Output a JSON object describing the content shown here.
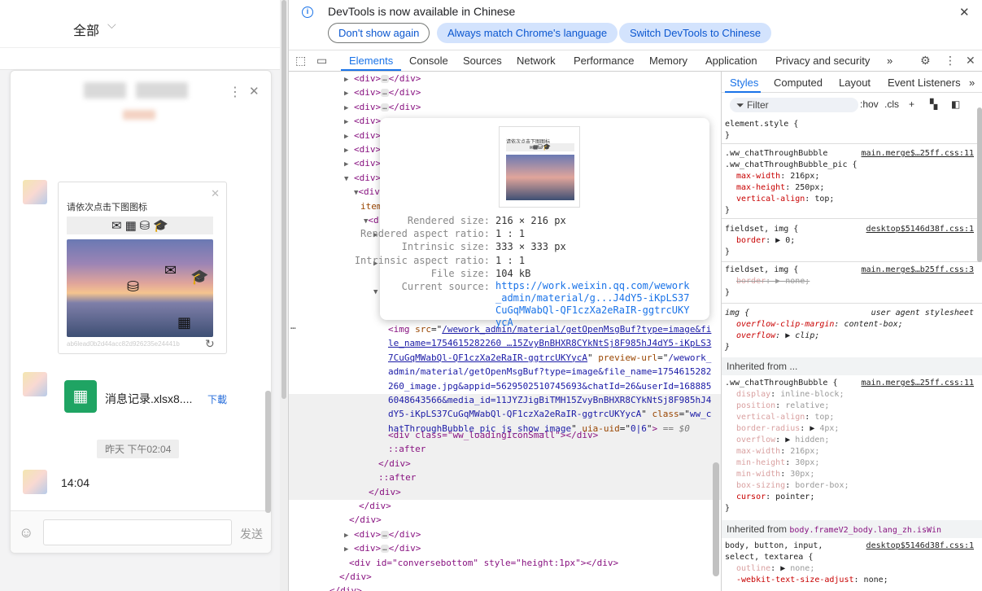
{
  "left": {
    "filter_label": "全部",
    "chat": {
      "card_title": "请依次点击下图图标",
      "card_hash": "ab6lead0b2d44acc82d926235e24441b",
      "file_name": "消息记录.xlsx8....",
      "download": "下載",
      "timestamp": "昨天 下午02:04",
      "text_message": "14:04",
      "send": "发送"
    }
  },
  "devtools": {
    "infobar": {
      "message": "DevTools is now available in Chinese",
      "btn_dont_show": "Don't show again",
      "btn_match": "Always match Chrome's language",
      "btn_switch": "Switch DevTools to Chinese"
    },
    "tabs": [
      "Elements",
      "Console",
      "Sources",
      "Network",
      "Performance",
      "Memory",
      "Application",
      "Privacy and security"
    ],
    "more": "»",
    "tooltip": {
      "rendered_size_k": "Rendered size:",
      "rendered_size_v": "216 × 216 px",
      "rendered_ratio_k": "Rendered aspect ratio:",
      "rendered_ratio_v": "1 : 1",
      "intrinsic_size_k": "Intrinsic size:",
      "intrinsic_size_v": "333 × 333 px",
      "intrinsic_ratio_k": "Intrinsic aspect ratio:",
      "intrinsic_ratio_v": "1 : 1",
      "file_size_k": "File size:",
      "file_size_v": "104 kB",
      "source_k": "Current source:",
      "source_v": "https://work.weixin.qq.com/wework_admin/material/g...J4dY5-iKpLS37CuGqMWabQl-QF1czXa2eRaIR-ggtrcUKYycA"
    },
    "elements": {
      "div_close": "</div>",
      "div_open": "<div>",
      "item_partial": "item",
      "img_src": "/wework_admin/material/getOpenMsgBuf?type=image&file_name=1754615282260 …15ZvyBnBHXR8CYkNtSj8F985hJ4dY5-iKpLS37CuGqMWabQl-QF1czXa2eRaIR-ggtrcUKYycA",
      "img_preview": "/wework_admin/material/getOpenMsgBuf?type=image&file_name=1754615282260_image.jpg&appid=5629502510745693&chatId=26&userId=1688856048643566&media_id=11JYZJigBiTMH15ZvyBnBHXR8CYkNtSj8F985hJ4dY5-iKpLS37CuGqMWabQl-QF1czXa2eRaIR-ggtrcUKYycA",
      "img_class": "ww_chatThroughBubble_pic js_show_image",
      "img_uia": "0|6",
      "eq": "== $0",
      "loading": "<div class=\"ww_loadingIconSmall\"></div>",
      "after": "::after",
      "conversebottom": "<div id=\"conversebottom\" style=\"height:1px\"></div>"
    },
    "styles": {
      "tabs": [
        "Styles",
        "Computed",
        "Layout",
        "Event Listeners"
      ],
      "filter": "Filter",
      "hov": ":hov",
      "cls": ".cls",
      "element_style": "element.style {",
      "r1_sel1": ".ww_chatThroughBubble",
      "r1_sel2": ".ww_chatThroughBubble_pic {",
      "r1_src": "main.merge$…25ff.css:11",
      "r1_p1": "max-width",
      "r1_v1": "216px;",
      "r1_p2": "max-height",
      "r1_v2": "250px;",
      "r1_p3": "vertical-align",
      "r1_v3": "top;",
      "r2_sel": "fieldset, img {",
      "r2_src": "desktop$5146d38f.css:1",
      "r2_p1": "border",
      "r2_v1": "0;",
      "r3_sel": "fieldset, img {",
      "r3_src": "main.merge$…b25ff.css:3",
      "r3_p1": "border",
      "r3_v1": "none;",
      "r4_sel": "img {",
      "r4_src": "user agent stylesheet",
      "r4_p1": "overflow-clip-margin",
      "r4_v1": "content-box;",
      "r4_p2": "overflow",
      "r4_v2": "clip;",
      "inh1": "Inherited from ...",
      "r5_sel": ".ww_chatThroughBubble {",
      "r5_src": "main.merge$…25ff.css:11",
      "r5_props": [
        {
          "n": "display",
          "v": "inline-block;"
        },
        {
          "n": "position",
          "v": "relative;"
        },
        {
          "n": "vertical-align",
          "v": "top;"
        },
        {
          "n": "border-radius",
          "v": "4px;"
        },
        {
          "n": "overflow",
          "v": "hidden;"
        },
        {
          "n": "max-width",
          "v": "216px;"
        },
        {
          "n": "min-height",
          "v": "30px;"
        },
        {
          "n": "min-width",
          "v": "30px;"
        },
        {
          "n": "box-sizing",
          "v": "border-box;"
        },
        {
          "n": "cursor",
          "v": "pointer;"
        }
      ],
      "inh2_prefix": "Inherited from",
      "inh2_el": "body.frameV2_body.lang_zh.isWin",
      "r6_sel1": "body, button, input,",
      "r6_sel2": "select, textarea {",
      "r6_src": "desktop$5146d38f.css:1",
      "r6_p1": "outline",
      "r6_v1": "none;",
      "r6_p2": "-webkit-text-size-adjust",
      "r6_v2": "none;"
    }
  }
}
